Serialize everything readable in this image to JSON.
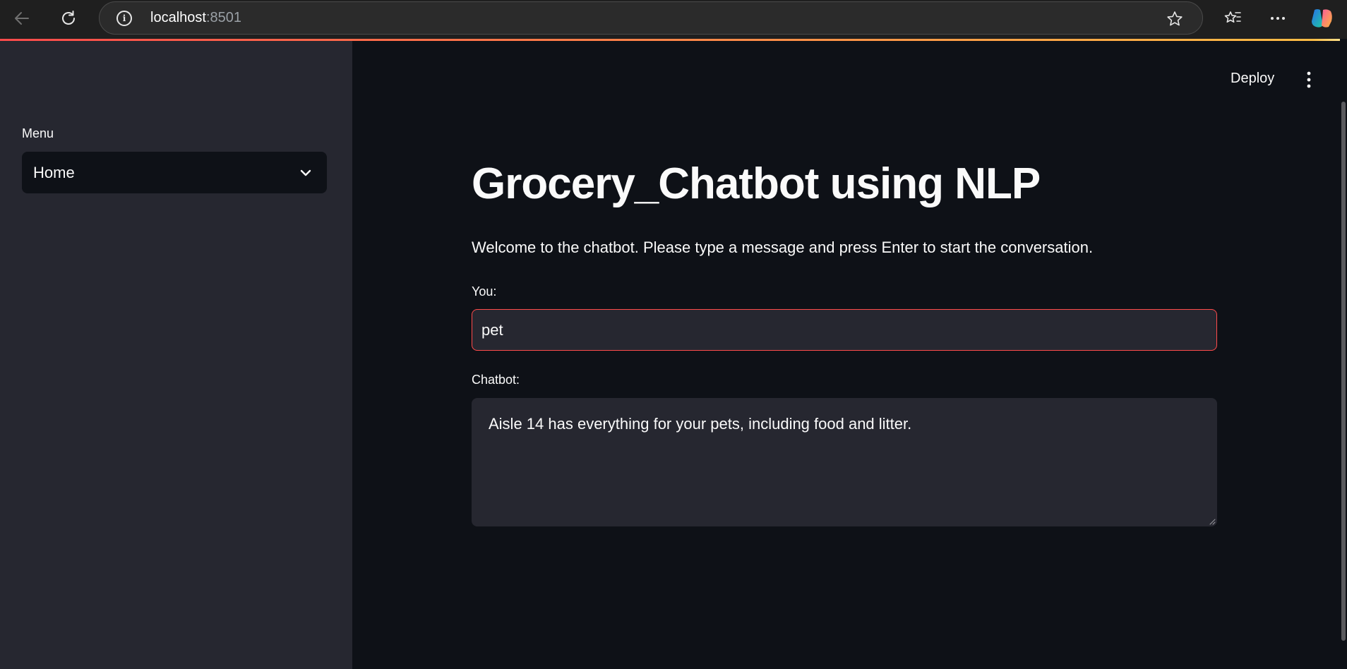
{
  "browser": {
    "url_host": "localhost",
    "url_port": ":8501"
  },
  "sidebar": {
    "menu_label": "Menu",
    "menu_selected": "Home"
  },
  "header": {
    "deploy_label": "Deploy"
  },
  "main": {
    "title": "Grocery_Chatbot using NLP",
    "welcome": "Welcome to the chatbot. Please type a message and press Enter to start the conversation.",
    "you_label": "You:",
    "you_value": "pet",
    "chatbot_label": "Chatbot:",
    "chatbot_value": "Aisle 14 has everything for your pets, including food and litter."
  },
  "colors": {
    "accent": "#ff4b4b",
    "background": "#0e1117",
    "sidebar": "#262730",
    "text": "#fafafa"
  },
  "icons": [
    "back-arrow-icon",
    "reload-icon",
    "info-icon",
    "star-icon",
    "favorites-icon",
    "more-icon",
    "copilot-icon",
    "chevron-down-icon",
    "kebab-icon",
    "resize-handle-icon"
  ]
}
